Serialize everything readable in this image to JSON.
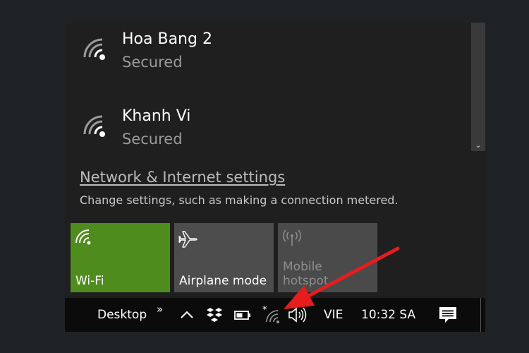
{
  "networks": [
    {
      "name": "Hoa Bang 2",
      "status": "Secured"
    },
    {
      "name": "Khanh Vi",
      "status": "Secured"
    }
  ],
  "settings": {
    "link": "Network & Internet settings",
    "description": "Change settings, such as making a connection metered."
  },
  "tiles": [
    {
      "label": "Wi-Fi",
      "icon": "wifi-icon",
      "state": "on",
      "color": "#4e8c1e"
    },
    {
      "label": "Airplane mode",
      "icon": "airplane-icon",
      "state": "off"
    },
    {
      "label": "Mobile\nhotspot",
      "icon": "hotspot-icon",
      "state": "disabled"
    }
  ],
  "taskbar": {
    "desktop": "Desktop",
    "chevron": "»",
    "language": "VIE",
    "time": "10:32 SA",
    "icons": [
      "chevron-up-icon",
      "dropbox-icon",
      "battery-icon",
      "wifi-icon",
      "volume-icon",
      "notification-icon"
    ]
  },
  "annotation": {
    "arrow_color": "#e51d1d",
    "points_to": "wifi-icon"
  }
}
